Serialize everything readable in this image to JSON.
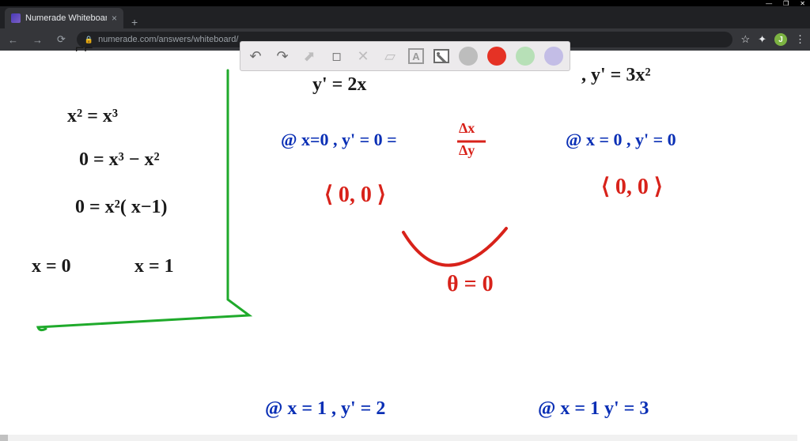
{
  "window": {
    "min_icon": "—",
    "max_icon": "❐",
    "close_icon": "✕"
  },
  "browser": {
    "tab_title": "Numerade Whiteboard",
    "tab_close": "×",
    "newtab": "+",
    "back": "←",
    "forward": "→",
    "reload": "⟳",
    "lock": "🔒",
    "url": "numerade.com/answers/whiteboard/",
    "star": "☆",
    "ext": "✦",
    "avatar_letter": "J",
    "menu": "⋮"
  },
  "toolbar": {
    "undo": "↶",
    "redo": "↷",
    "pointer": "⬈",
    "eraser": "◇",
    "tools": "✕",
    "eraser2": "▱",
    "text_letter": "A",
    "colors": {
      "gray": "#bdbdbd",
      "red": "#e53225",
      "green": "#b7e0b7",
      "purple": "#c3bde6"
    }
  },
  "math": {
    "top_scribble": "⌐⌐",
    "left1": "x² = x³",
    "left2": "0 = x³ − x²",
    "left3": "0 = x²( x−1)",
    "left4a": "x = 0",
    "left4b": "x = 1",
    "mid_top": "y' = 2x",
    "mid_at": "@ x=0 ,  y' = 0  =",
    "mid_frac_top": "Δx",
    "mid_frac_bot": "Δy",
    "mid_vec": "⟨ 0, 0 ⟩",
    "mid_theta": "θ = 0",
    "right_top": ",  y' = 3x²",
    "right_at": "@  x = 0 , y' = 0",
    "right_vec": "⟨ 0, 0 ⟩",
    "bottom_left": "@ x = 1 ,   y' = 2",
    "bottom_right": "@ x = 1   y' = 3"
  }
}
